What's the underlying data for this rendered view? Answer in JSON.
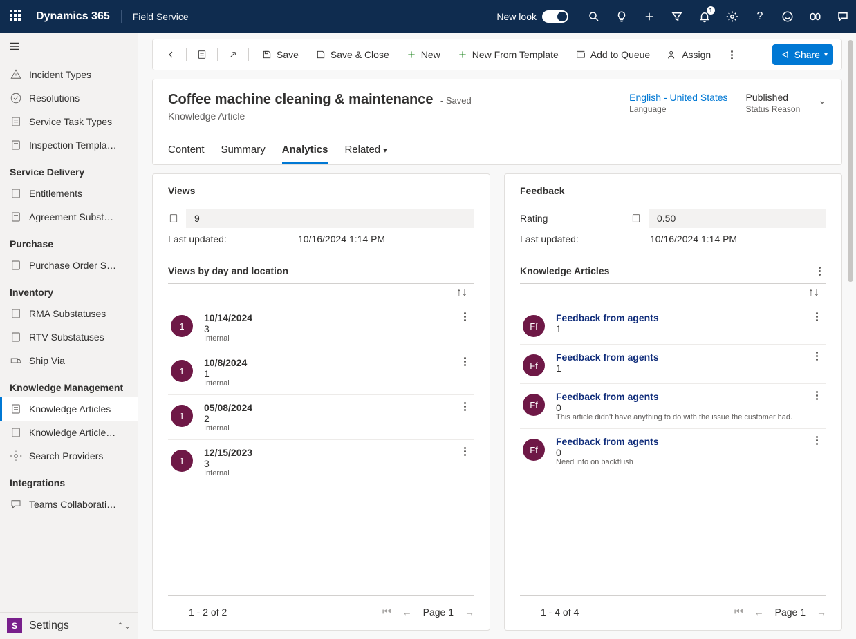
{
  "top": {
    "brand": "Dynamics 365",
    "app": "Field Service",
    "newlook": "New look",
    "notif_count": "1"
  },
  "sidebar": {
    "items_top": [
      {
        "label": "Incident Types"
      },
      {
        "label": "Resolutions"
      },
      {
        "label": "Service Task Types"
      },
      {
        "label": "Inspection Templa…"
      }
    ],
    "group_service": "Service Delivery",
    "items_service": [
      {
        "label": "Entitlements"
      },
      {
        "label": "Agreement Subst…"
      }
    ],
    "group_purchase": "Purchase",
    "items_purchase": [
      {
        "label": "Purchase Order S…"
      }
    ],
    "group_inventory": "Inventory",
    "items_inventory": [
      {
        "label": "RMA Substatuses"
      },
      {
        "label": "RTV Substatuses"
      },
      {
        "label": "Ship Via"
      }
    ],
    "group_km": "Knowledge Management",
    "items_km": [
      {
        "label": "Knowledge Articles",
        "active": true
      },
      {
        "label": "Knowledge Article…"
      },
      {
        "label": "Search Providers"
      }
    ],
    "group_int": "Integrations",
    "items_int": [
      {
        "label": "Teams Collaborati…"
      }
    ],
    "footer_avatar": "S",
    "footer_label": "Settings"
  },
  "commands": {
    "save": "Save",
    "save_close": "Save & Close",
    "new": "New",
    "new_template": "New From Template",
    "add_queue": "Add to Queue",
    "assign": "Assign",
    "share": "Share"
  },
  "header": {
    "title": "Coffee machine cleaning & maintenance",
    "saved": "- Saved",
    "subtitle": "Knowledge Article",
    "lang_value": "English - United States",
    "lang_label": "Language",
    "status_value": "Published",
    "status_label": "Status Reason",
    "tabs": {
      "content": "Content",
      "summary": "Summary",
      "analytics": "Analytics",
      "related": "Related"
    }
  },
  "views": {
    "title": "Views",
    "count": "9",
    "updated_label": "Last updated:",
    "updated_value": "10/16/2024 1:14 PM",
    "list_title": "Views by day and location",
    "items": [
      {
        "avatar": "1",
        "date": "10/14/2024",
        "count": "3",
        "tag": "Internal"
      },
      {
        "avatar": "1",
        "date": "10/8/2024",
        "count": "1",
        "tag": "Internal"
      },
      {
        "avatar": "1",
        "date": "05/08/2024",
        "count": "2",
        "tag": "Internal"
      },
      {
        "avatar": "1",
        "date": "12/15/2023",
        "count": "3",
        "tag": "Internal"
      }
    ],
    "pager_range": "1 - 2 of 2",
    "pager_page": "Page 1"
  },
  "feedback": {
    "title": "Feedback",
    "rating_label": "Rating",
    "rating_value": "0.50",
    "updated_label": "Last updated:",
    "updated_value": "10/16/2024 1:14 PM",
    "list_title": "Knowledge Articles",
    "items": [
      {
        "avatar": "Ff",
        "title": "Feedback from agents",
        "count": "1",
        "note": ""
      },
      {
        "avatar": "Ff",
        "title": "Feedback from agents",
        "count": "1",
        "note": ""
      },
      {
        "avatar": "Ff",
        "title": "Feedback from agents",
        "count": "0",
        "note": "This article didn't have anything to do with the issue the customer had."
      },
      {
        "avatar": "Ff",
        "title": "Feedback from agents",
        "count": "0",
        "note": "Need info on backflush"
      }
    ],
    "pager_range": "1 - 4 of 4",
    "pager_page": "Page 1"
  }
}
